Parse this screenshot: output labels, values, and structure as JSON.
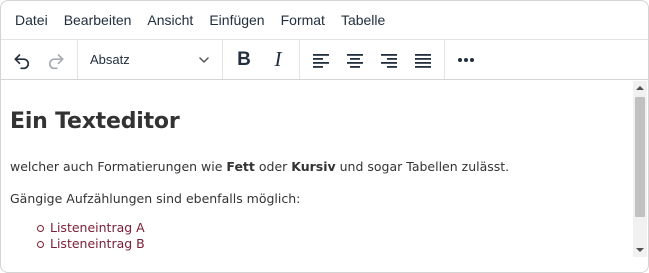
{
  "menu": {
    "items": [
      "Datei",
      "Bearbeiten",
      "Ansicht",
      "Einfügen",
      "Format",
      "Tabelle"
    ]
  },
  "toolbar": {
    "block_format": "Absatz",
    "bold_label": "B",
    "italic_label": "I",
    "icons": [
      "undo-icon",
      "redo-icon",
      "chevron-down-icon",
      "align-left-icon",
      "align-center-icon",
      "align-right-icon",
      "align-justify-icon",
      "more-icon"
    ]
  },
  "content": {
    "heading": "Ein Texteditor",
    "para1": {
      "t1": "welcher auch Formatierungen wie ",
      "b1": "Fett",
      "t2": " oder ",
      "b2": "Kursiv",
      "t3": " und sogar Tabellen zulässt."
    },
    "para2": "Gängige Aufzählungen sind ebenfalls möglich:",
    "list": [
      "Listeneintrag A",
      "Listeneintrag B"
    ]
  },
  "colors": {
    "text": "#333333",
    "toolbar_text": "#222f3e",
    "list_text": "#7a1d35",
    "scrollbar_thumb": "#c1c1c1"
  }
}
